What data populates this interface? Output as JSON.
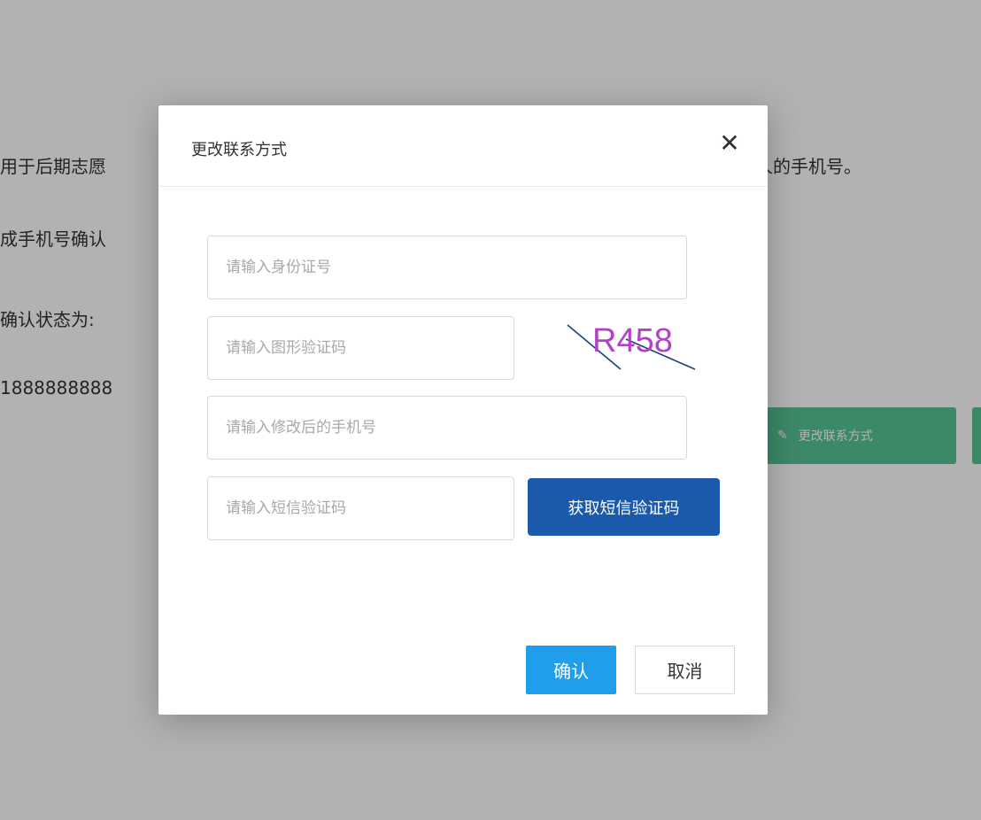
{
  "background": {
    "lines": [
      "用于后期志愿",
      "成手机号确认",
      "确认状态为:",
      "1888888888"
    ],
    "right_text": "人的手机号。",
    "change_contact_button": "更改联系方式"
  },
  "dialog": {
    "title": "更改联系方式",
    "close_symbol": "✕",
    "id_placeholder": "请输入身份证号",
    "captcha_placeholder": "请输入图形验证码",
    "captcha_text": "R458",
    "phone_placeholder": "请输入修改后的手机号",
    "sms_placeholder": "请输入短信验证码",
    "sms_button": "获取短信验证码",
    "confirm_button": "确认",
    "cancel_button": "取消"
  },
  "colors": {
    "overlay": "rgba(0,0,0,0.3)",
    "primary": "#1f9eec",
    "sms_button": "#1b5aab",
    "background_button": "#56c596",
    "captcha_text": "#b340c9"
  }
}
